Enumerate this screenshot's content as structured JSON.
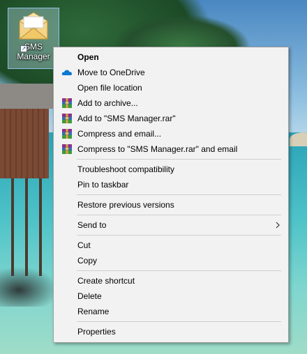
{
  "desktop": {
    "icon": {
      "label_line1": "SMS",
      "label_line2": "Manager",
      "icon_name": "mail-envelope-icon"
    }
  },
  "menu": {
    "open": "Open",
    "onedrive": "Move to OneDrive",
    "open_location": "Open file location",
    "add_archive": "Add to archive...",
    "add_rar": "Add to \"SMS Manager.rar\"",
    "compress_email": "Compress and email...",
    "compress_rar_email": "Compress to \"SMS Manager.rar\" and email",
    "troubleshoot": "Troubleshoot compatibility",
    "pin_taskbar": "Pin to taskbar",
    "restore_versions": "Restore previous versions",
    "send_to": "Send to",
    "cut": "Cut",
    "copy": "Copy",
    "create_shortcut": "Create shortcut",
    "delete": "Delete",
    "rename": "Rename",
    "properties": "Properties"
  },
  "icons": {
    "onedrive": "onedrive-cloud-icon",
    "winrar": "winrar-archive-icon",
    "submenu": "chevron-right-icon"
  },
  "colors": {
    "menu_bg": "#f2f2f2",
    "onedrive_blue": "#0f78d4",
    "selection_bg": "#cce8ff"
  }
}
